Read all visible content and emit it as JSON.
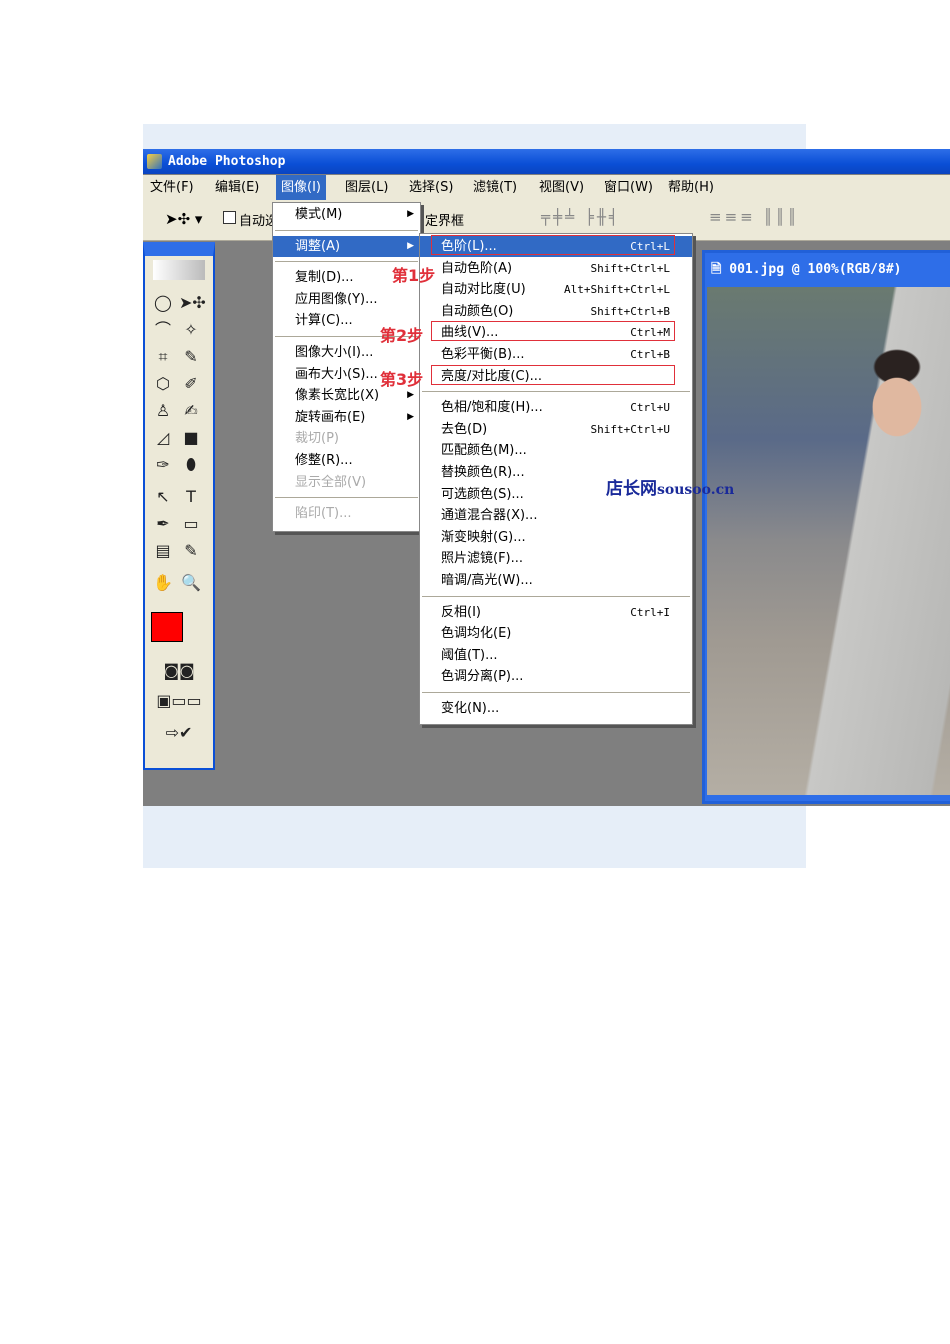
{
  "window": {
    "title": "Adobe Photoshop"
  },
  "menubar": [
    "文件(F)",
    "编辑(E)",
    "图像(I)",
    "图层(L)",
    "选择(S)",
    "滤镜(T)",
    "视图(V)",
    "窗口(W)",
    "帮助(H)"
  ],
  "toolbar": {
    "auto_select": "自动选",
    "bounding_box": "定界框"
  },
  "image_menu": [
    {
      "label": "模式(M)",
      "sub": true
    },
    {
      "sep": true
    },
    {
      "label": "调整(A)",
      "sub": true,
      "hi": true
    },
    {
      "sep": true
    },
    {
      "label": "复制(D)..."
    },
    {
      "label": "应用图像(Y)..."
    },
    {
      "label": "计算(C)..."
    },
    {
      "sep": true
    },
    {
      "label": "图像大小(I)..."
    },
    {
      "label": "画布大小(S)..."
    },
    {
      "label": "像素长宽比(X)",
      "sub": true
    },
    {
      "label": "旋转画布(E)",
      "sub": true
    },
    {
      "label": "裁切(P)",
      "dis": true
    },
    {
      "label": "修整(R)..."
    },
    {
      "label": "显示全部(V)",
      "dis": true
    },
    {
      "sep": true
    },
    {
      "label": "陷印(T)...",
      "dis": true
    }
  ],
  "adjust_menu": [
    {
      "label": "色阶(L)...",
      "sc": "Ctrl+L",
      "hi": true,
      "box": true
    },
    {
      "label": "自动色阶(A)",
      "sc": "Shift+Ctrl+L"
    },
    {
      "label": "自动对比度(U)",
      "sc": "Alt+Shift+Ctrl+L"
    },
    {
      "label": "自动颜色(O)",
      "sc": "Shift+Ctrl+B"
    },
    {
      "label": "曲线(V)...",
      "sc": "Ctrl+M",
      "box": true
    },
    {
      "label": "色彩平衡(B)...",
      "sc": "Ctrl+B"
    },
    {
      "label": "亮度/对比度(C)...",
      "box": true
    },
    {
      "sep": true
    },
    {
      "label": "色相/饱和度(H)...",
      "sc": "Ctrl+U"
    },
    {
      "label": "去色(D)",
      "sc": "Shift+Ctrl+U"
    },
    {
      "label": "匹配颜色(M)..."
    },
    {
      "label": "替换颜色(R)..."
    },
    {
      "label": "可选颜色(S)..."
    },
    {
      "label": "通道混合器(X)..."
    },
    {
      "label": "渐变映射(G)..."
    },
    {
      "label": "照片滤镜(F)..."
    },
    {
      "label": "暗调/高光(W)..."
    },
    {
      "sep": true
    },
    {
      "label": "反相(I)",
      "sc": "Ctrl+I"
    },
    {
      "label": "色调均化(E)"
    },
    {
      "label": "阈值(T)..."
    },
    {
      "label": "色调分离(P)..."
    },
    {
      "sep": true
    },
    {
      "label": "变化(N)..."
    }
  ],
  "steps": [
    "第1步",
    "第2步",
    "第3步"
  ],
  "document": {
    "title": "001.jpg @ 100%(RGB/8#)"
  },
  "watermark": {
    "cn": "店长网",
    "en": "sousoo.cn"
  },
  "colors": {
    "foreground": "#ff0000",
    "background": "#ffffff",
    "highlight": "#316ac5",
    "annotation": "#e0303a"
  }
}
